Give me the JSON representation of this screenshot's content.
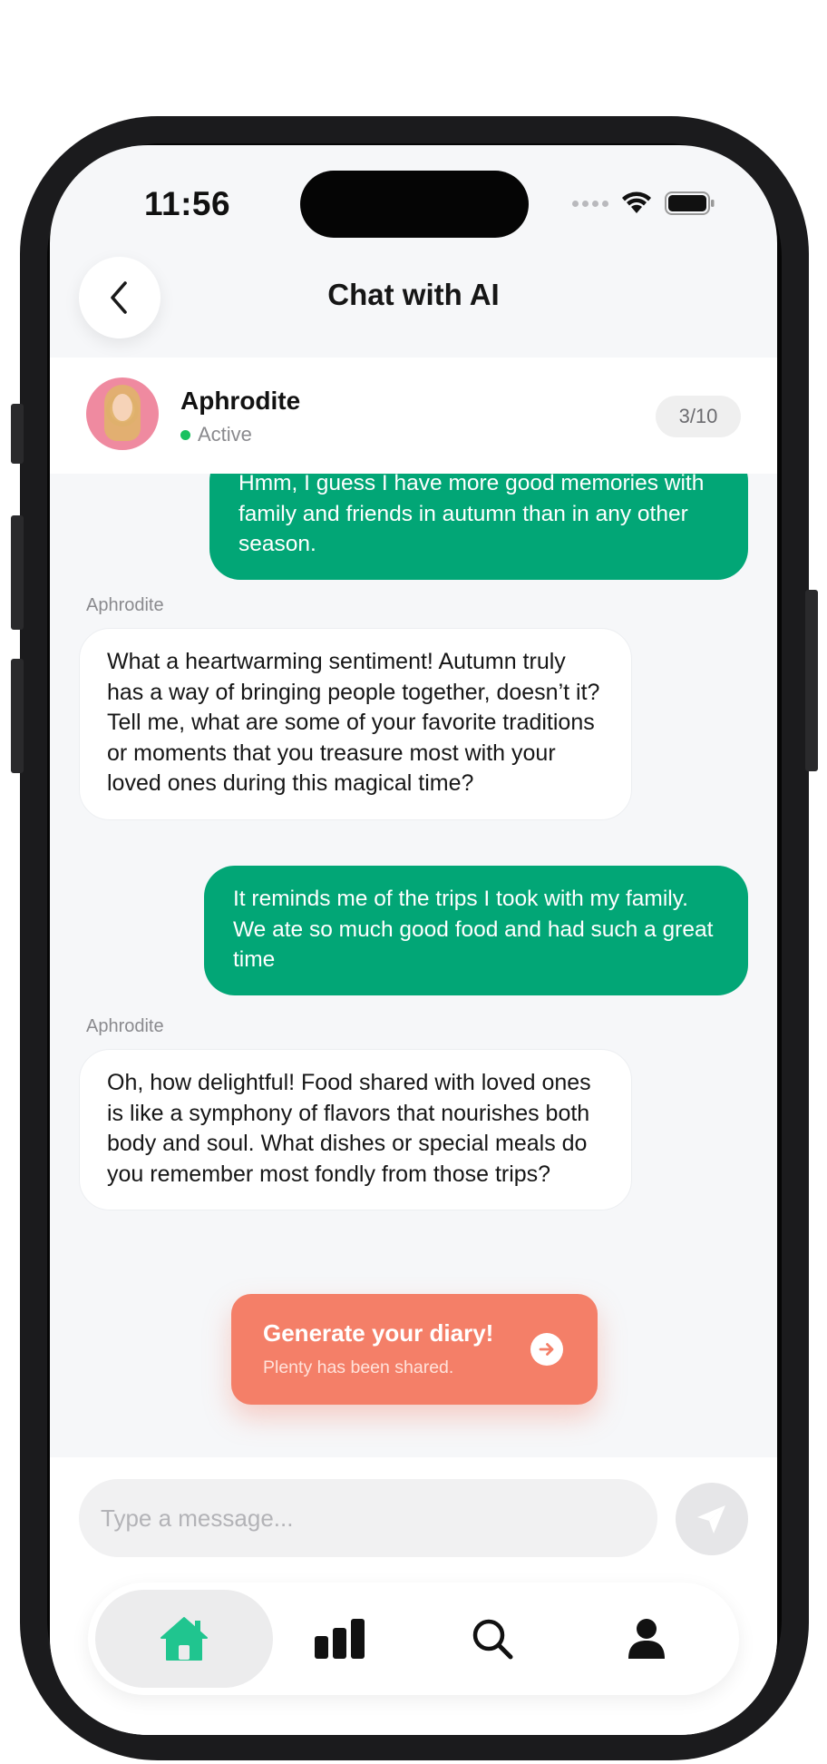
{
  "status_bar": {
    "time": "11:56"
  },
  "header": {
    "title": "Chat with AI"
  },
  "profile": {
    "name": "Aphrodite",
    "status": "Active",
    "message_count": "3/10"
  },
  "messages": [
    {
      "role": "user",
      "text": "Hmm, I guess I have more good memories with family and friends in autumn than in any other season."
    },
    {
      "role": "ai",
      "sender": "Aphrodite",
      "text": "What a heartwarming sentiment! Autumn truly has a way of bringing people together, doesn’t it? Tell me, what are some of your favorite traditions or moments that you treasure most with your loved ones during this magical time?"
    },
    {
      "role": "user",
      "text": "It reminds me of the trips I took with my family. We ate so much good food and had such a great time"
    },
    {
      "role": "ai",
      "sender": "Aphrodite",
      "text": "Oh, how delightful! Food shared with loved ones is like a symphony of flavors that nourishes both body and soul. What dishes or special meals do you remember most fondly from those trips?"
    }
  ],
  "diary_cta": {
    "title": "Generate your diary!",
    "subtitle": "Plenty has been shared."
  },
  "composer": {
    "placeholder": "Type a message..."
  },
  "tabs": [
    {
      "name": "home",
      "icon": "home-icon",
      "active": true
    },
    {
      "name": "stats",
      "icon": "bar-chart-icon",
      "active": false
    },
    {
      "name": "search",
      "icon": "search-icon",
      "active": false
    },
    {
      "name": "profile",
      "icon": "person-icon",
      "active": false
    }
  ],
  "colors": {
    "accent_green": "#02a676",
    "cta_coral": "#f47f68",
    "tab_active_icon": "#20c58f",
    "active_dot": "#19c15f"
  }
}
